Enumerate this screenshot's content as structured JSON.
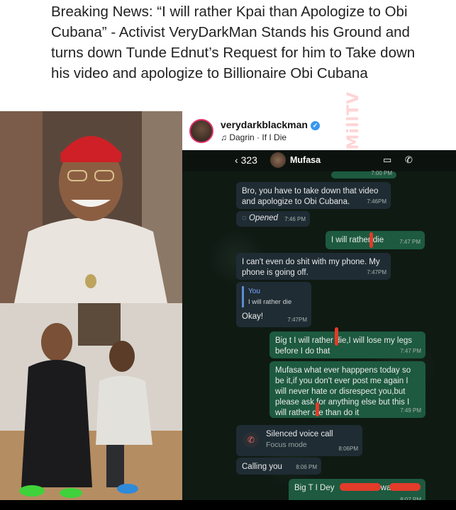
{
  "headline": "Breaking News: “I will rather Kpai than Apologize to Obi Cubana” - Activist VeryDarkMan Stands his Ground and turns down Tunde Ednut’s Request for him to Take down his video and apologize to Billionaire Obi Cubana",
  "watermark": "GossipMillTV",
  "post": {
    "username": "verydarkblackman",
    "song": "Dagrin · If I Die"
  },
  "chat": {
    "back_count": "323",
    "contact": "Mufasa",
    "top_time": "7:00 PM",
    "messages": [
      {
        "text": "Bro, you have to take down that video and apologize to Obi Cubana.",
        "time": "7:46PM"
      },
      {
        "text": "Opened",
        "time": "7:46 PM"
      },
      {
        "text": "I will rather die",
        "time": "7:47 PM"
      },
      {
        "text": "I can't even do shit with my phone. My phone is going off.",
        "time": "7:47PM"
      },
      {
        "quote_name": "You",
        "quote_text": "I will rather die",
        "text": "Okay!",
        "time": "7:47PM"
      },
      {
        "text": "Big t I will rather die,I will lose my legs before I do that",
        "time": "7:47 PM"
      },
      {
        "text": "Mufasa what ever happpens today so be it,if you don't ever post me again I will never hate or disrespect you,but please ask for anything else but this I will rather die than do it",
        "time": "7:49 PM"
      },
      {
        "title": "Silenced voice call",
        "subtitle": "Focus mode",
        "time": "8:06PM"
      },
      {
        "text": "Calling you",
        "time": "8:06 PM"
      },
      {
        "text": "Big T I Dey",
        "text2": "want",
        "time": "8:07 PM"
      }
    ]
  }
}
